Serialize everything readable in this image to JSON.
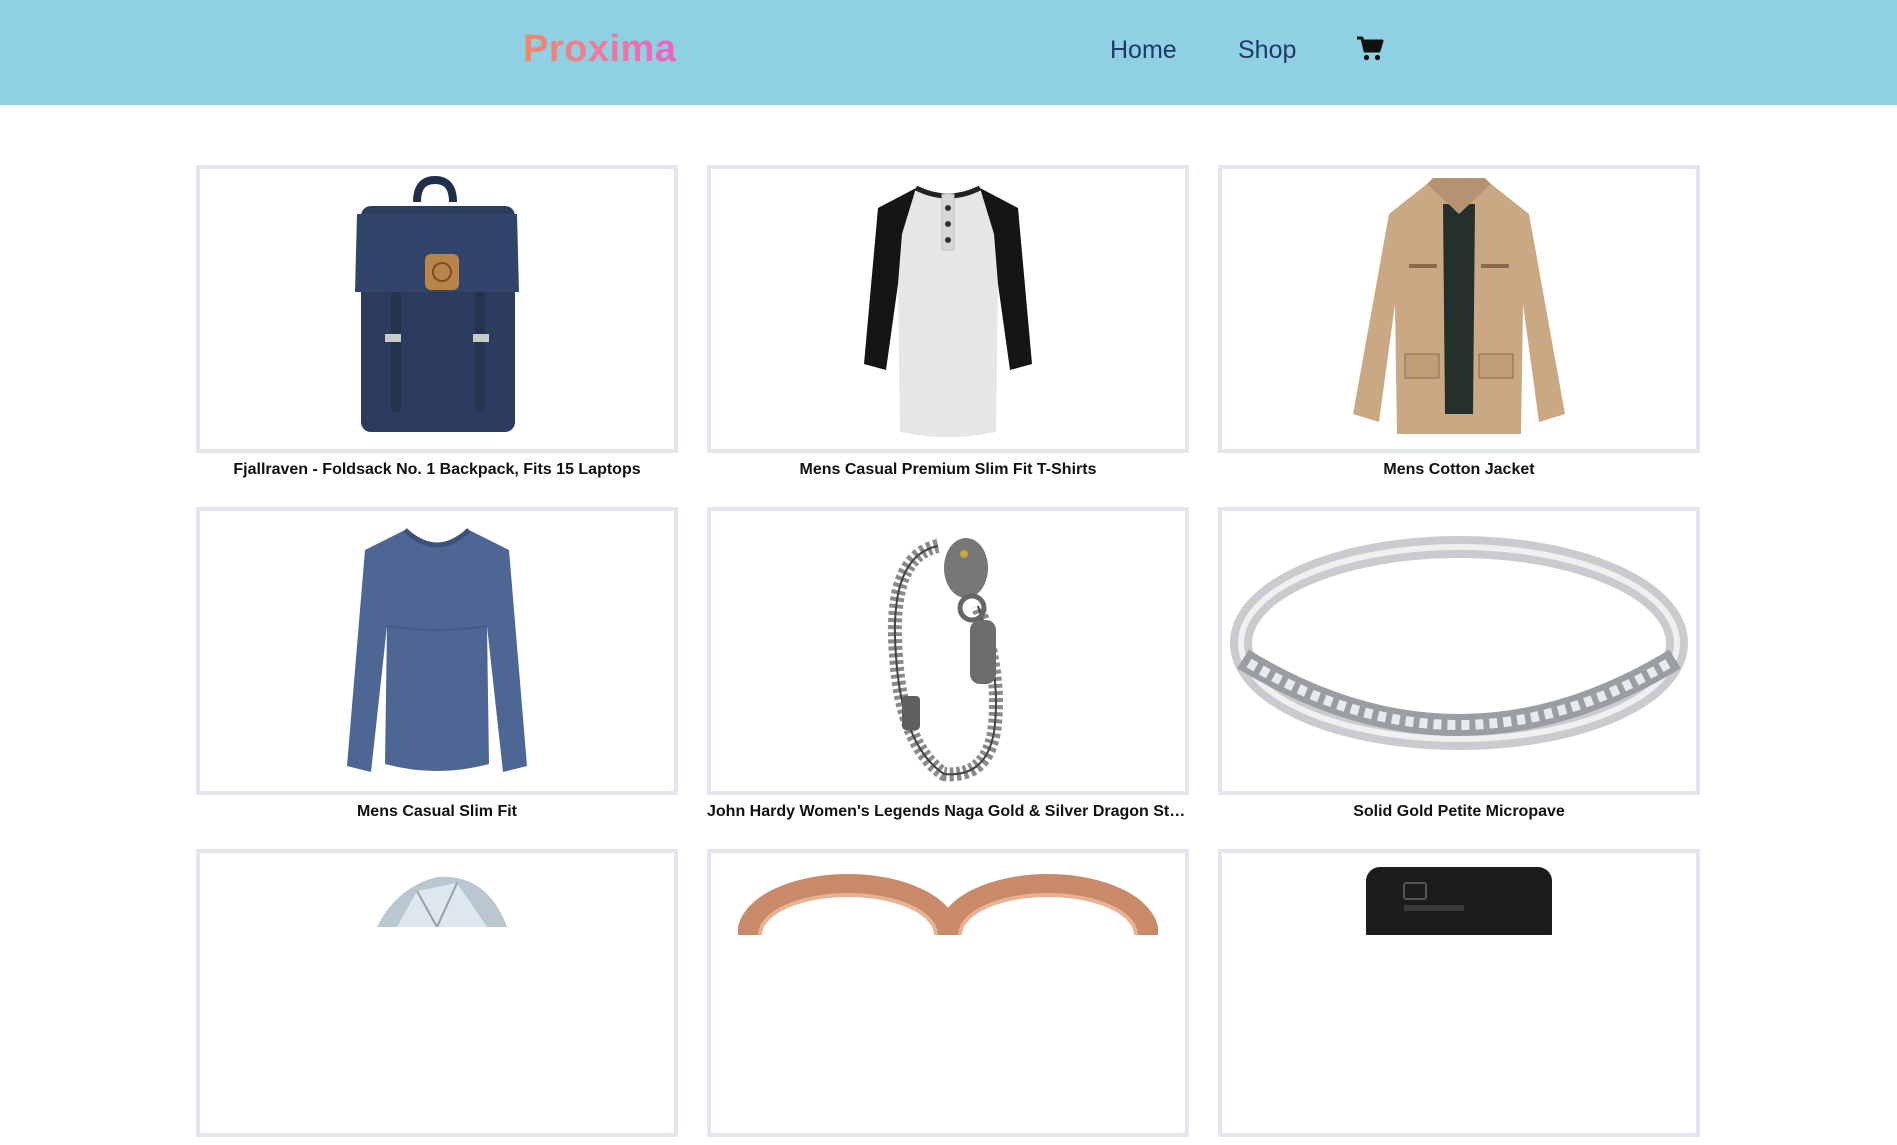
{
  "brand": {
    "logo": "Proxima"
  },
  "nav": {
    "home": "Home",
    "shop": "Shop",
    "cart_icon": "cart-icon"
  },
  "colors": {
    "header_bg": "#8fd0e3",
    "nav_text": "#1d3a6b",
    "logo_gradient": [
      "#f2876a",
      "#ee62c6"
    ],
    "card_border": "#e1e6ef"
  },
  "products": [
    {
      "title": "Fjallraven - Foldsack No. 1 Backpack, Fits 15 Laptops",
      "image": "navy-backpack"
    },
    {
      "title": "Mens Casual Premium Slim Fit T-Shirts",
      "image": "raglan-henley-tshirt"
    },
    {
      "title": "Mens Cotton Jacket",
      "image": "khaki-cotton-jacket"
    },
    {
      "title": "Mens Casual Slim Fit",
      "image": "blue-long-sleeve-shirt"
    },
    {
      "title": "John Hardy Women's Legends Naga Gold & Silver Dragon Station ...",
      "image": "dragon-chain-bracelet"
    },
    {
      "title": "Solid Gold Petite Micropave",
      "image": "silver-micropave-ring"
    },
    {
      "title": "",
      "image": "diamond-ring"
    },
    {
      "title": "",
      "image": "rose-gold-rings"
    },
    {
      "title": "",
      "image": "external-hard-drive"
    }
  ]
}
